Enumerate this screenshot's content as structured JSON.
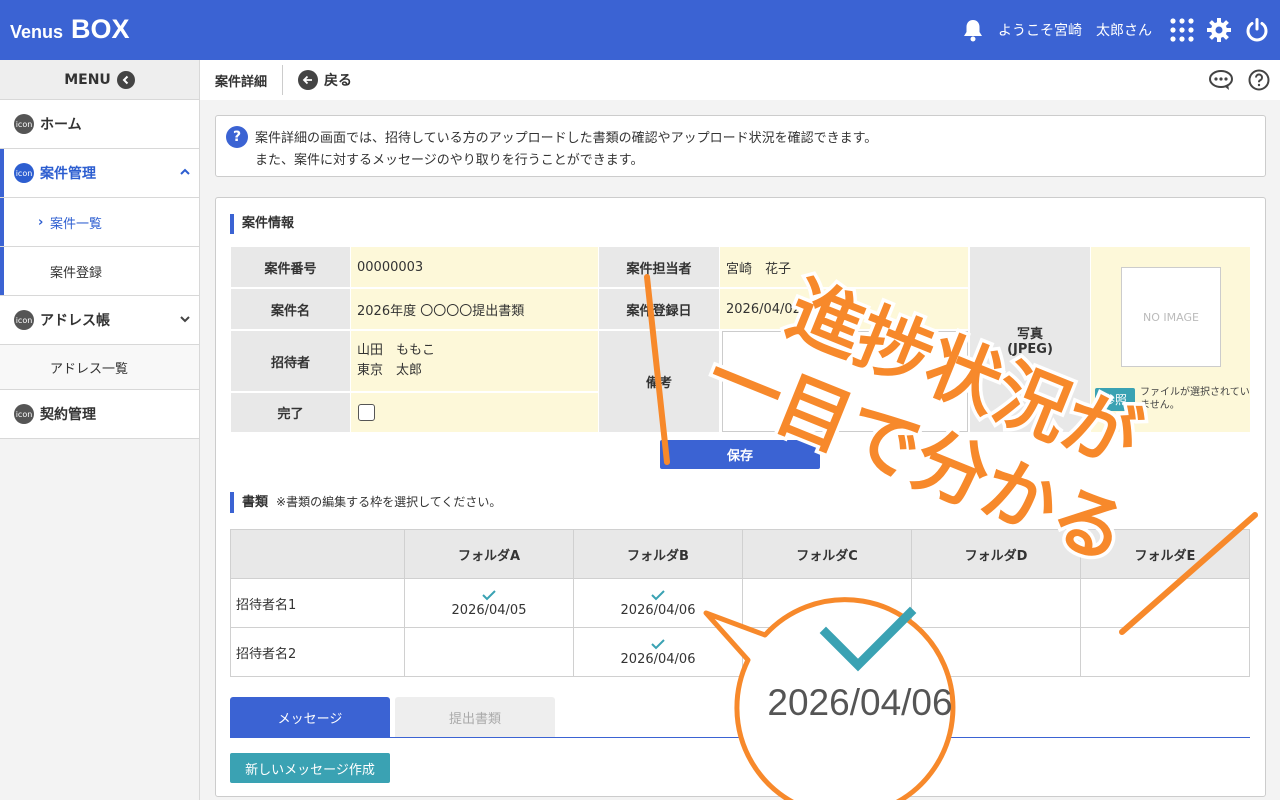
{
  "header": {
    "logo_venus": "Venus",
    "logo_box": "BOX",
    "welcome": "ようこそ宮崎　太郎さん",
    "icons": [
      "bell-icon",
      "apps-grid-icon",
      "gear-icon",
      "power-icon"
    ],
    "bg_color": "#3b63d3"
  },
  "sidebar": {
    "menu_label": "MENU",
    "icon_badge": "icon",
    "items": {
      "home": "ホーム",
      "case_mgmt": "案件管理",
      "case_list": "案件一覧",
      "case_register": "案件登録",
      "address_book": "アドレス帳",
      "address_list": "アドレス一覧",
      "contract": "契約管理"
    }
  },
  "breadcrumb": {
    "title": "案件詳細",
    "back": "戻る"
  },
  "info": {
    "line1": "案件詳細の画面では、招待している方のアップロードした書類の確認やアップロード状況を確認できます。",
    "line2": "また、案件に対するメッセージのやり取りを行うことができます。"
  },
  "case_info": {
    "section_title": "案件情報",
    "labels": {
      "case_no": "案件番号",
      "case_name": "案件名",
      "invitee": "招待者",
      "done": "完了",
      "manager": "案件担当者",
      "reg_date": "案件登録日",
      "remarks": "備考",
      "photo": "写真",
      "photo_fmt": "(JPEG)"
    },
    "values": {
      "case_no": "00000003",
      "case_name": "2026年度 〇〇〇〇提出書類",
      "invitee_1": "山田　ももこ",
      "invitee_2": "東京　太郎",
      "manager": "宮崎　花子",
      "reg_date": "2026/04/02"
    },
    "no_image": "NO IMAGE",
    "ref_button": "参照",
    "file_status": "ファイルが選択されていません。",
    "save_button": "保存"
  },
  "documents": {
    "section_title": "書類",
    "note": "※書類の編集する枠を選択してください。",
    "folders": [
      "フォルダA",
      "フォルダB",
      "フォルダC",
      "フォルダD",
      "フォルダE"
    ],
    "rows": [
      {
        "name": "招待者名1",
        "cells": [
          "2026/04/05",
          "2026/04/06",
          "",
          "",
          ""
        ]
      },
      {
        "name": "招待者名2",
        "cells": [
          "",
          "2026/04/06",
          "",
          "",
          ""
        ]
      }
    ]
  },
  "tabs": {
    "message": "メッセージ",
    "submitted": "提出書類"
  },
  "new_message_button": "新しいメッセージ作成",
  "overlay": {
    "caption_line1": "進捗状況が",
    "caption_line2": "一目で分かる",
    "zoom_date": "2026/04/06",
    "accent_color": "#f7892b",
    "check_color": "#3aa2b3"
  }
}
